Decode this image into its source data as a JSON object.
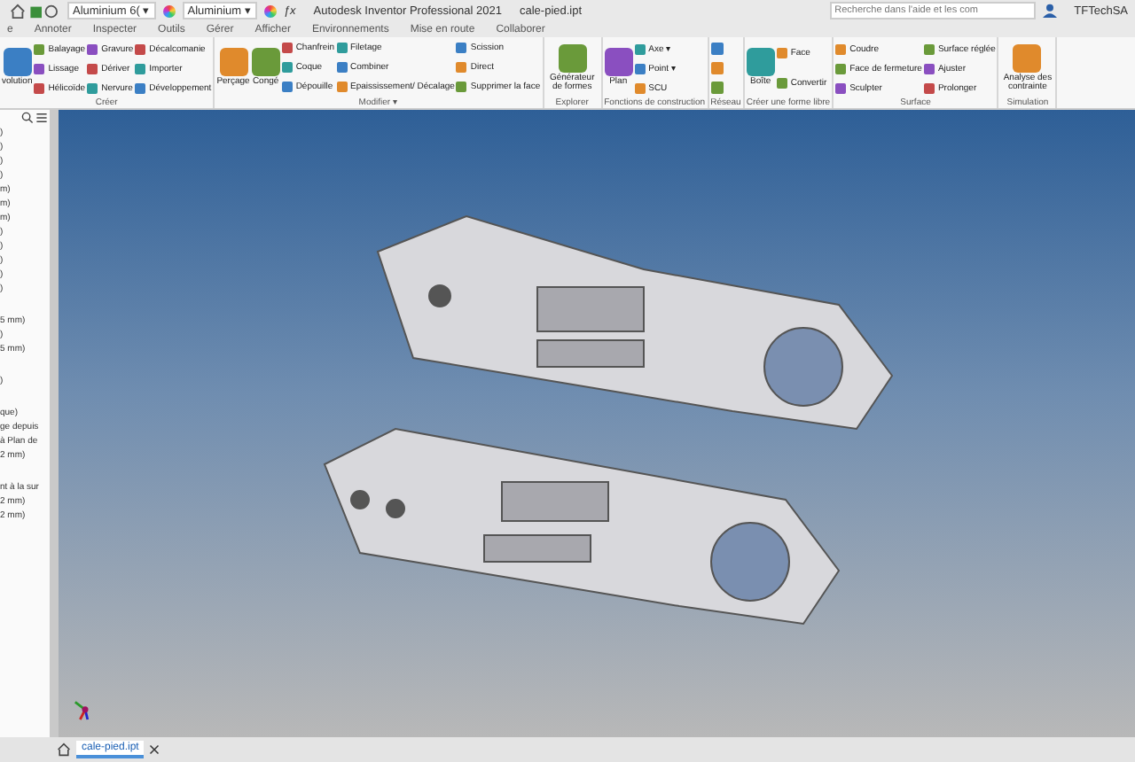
{
  "title_bar": {
    "material": "Aluminium 6(",
    "material_caret": "▾",
    "appearance": "Aluminium",
    "appearance_caret": "▾",
    "formula": "ƒx",
    "title": "Autodesk Inventor Professional 2021",
    "file": "cale-pied.ipt",
    "search": {
      "placeholder": "Recherche dans l'aide et les com"
    },
    "user": "TFTechSA"
  },
  "menu_tabs": [
    {
      "label": "e",
      "selected": false
    },
    {
      "label": "Annoter",
      "selected": false
    },
    {
      "label": "Inspecter",
      "selected": false
    },
    {
      "label": "Outils",
      "selected": false
    },
    {
      "label": "Gérer",
      "selected": false
    },
    {
      "label": "Afficher",
      "selected": false
    },
    {
      "label": "Environnements",
      "selected": false
    },
    {
      "label": "Mise en route",
      "selected": false
    },
    {
      "label": "Collaborer",
      "selected": false
    }
  ],
  "ribbon": [
    {
      "label": "Créer",
      "columns": [
        [
          {
            "label": "volution",
            "kind": "large"
          }
        ],
        [
          {
            "label": "Balayage",
            "kind": "small"
          },
          {
            "label": "Lissage",
            "kind": "small"
          },
          {
            "label": "Hélicoïde",
            "kind": "small"
          }
        ],
        [
          {
            "label": "Gravure",
            "kind": "small"
          },
          {
            "label": "Dériver",
            "kind": "small"
          },
          {
            "label": "Nervure",
            "kind": "small"
          }
        ],
        [
          {
            "label": "Décalcomanie",
            "kind": "small"
          },
          {
            "label": "Importer",
            "kind": "small"
          },
          {
            "label": "Développement",
            "kind": "small"
          }
        ]
      ]
    },
    {
      "label": "Modifier ▾",
      "columns": [
        [
          {
            "label": "Perçage",
            "kind": "large"
          }
        ],
        [
          {
            "label": "Congé",
            "kind": "large"
          }
        ],
        [
          {
            "label": "Chanfrein",
            "kind": "small"
          },
          {
            "label": "Coque",
            "kind": "small"
          },
          {
            "label": "Dépouille",
            "kind": "small"
          }
        ],
        [
          {
            "label": "Filetage",
            "kind": "small"
          },
          {
            "label": "Combiner",
            "kind": "small"
          },
          {
            "label": "Epaississement/ Décalage",
            "kind": "small"
          }
        ],
        [
          {
            "label": "Scission",
            "kind": "small"
          },
          {
            "label": "Direct",
            "kind": "small"
          },
          {
            "label": "Supprimer la face",
            "kind": "small"
          }
        ]
      ]
    },
    {
      "label": "Explorer",
      "columns": [
        [
          {
            "label": "Générateur de formes",
            "kind": "large"
          }
        ]
      ]
    },
    {
      "label": "Fonctions de construction",
      "columns": [
        [
          {
            "label": "Plan",
            "kind": "large"
          }
        ],
        [
          {
            "label": "Axe ▾",
            "kind": "small"
          },
          {
            "label": "Point ▾",
            "kind": "small"
          },
          {
            "label": "SCU",
            "kind": "small"
          }
        ]
      ]
    },
    {
      "label": "Réseau",
      "columns": [
        [
          {
            "kind": "icon"
          },
          {
            "kind": "icon"
          },
          {
            "kind": "icon"
          }
        ]
      ]
    },
    {
      "label": "Créer une forme libre",
      "columns": [
        [
          {
            "label": "Boîte",
            "kind": "large"
          }
        ],
        [
          {
            "label": "Face",
            "kind": "small"
          },
          {
            "label": "Convertir",
            "kind": "small"
          }
        ]
      ]
    },
    {
      "label": "Surface",
      "columns": [
        [
          {
            "label": "Coudre",
            "kind": "small"
          },
          {
            "label": "Face de fermeture",
            "kind": "small"
          },
          {
            "label": "Sculpter",
            "kind": "small"
          }
        ],
        [
          {
            "label": "Surface réglée",
            "kind": "small"
          },
          {
            "label": "Ajuster",
            "kind": "small"
          },
          {
            "label": "Prolonger",
            "kind": "small"
          }
        ]
      ]
    },
    {
      "label": "Simulation",
      "columns": [
        [
          {
            "label": "Analyse des contrainte",
            "kind": "large"
          }
        ]
      ]
    }
  ],
  "browser_panel": {
    "sections": [
      [
        ")",
        ")",
        ")",
        ")",
        "m)",
        "m)",
        "m)",
        ")",
        ")",
        ")",
        ")",
        ")"
      ],
      [
        "5 mm)",
        ")",
        "5 mm)"
      ],
      [
        ")"
      ],
      [
        "que)",
        "ge depuis",
        "à Plan de",
        "2 mm)"
      ],
      [
        "nt à la sur",
        "2 mm)",
        "2 mm)"
      ]
    ]
  },
  "document_tabs": [
    {
      "label": "cale-pied.ipt",
      "selected": true
    }
  ]
}
